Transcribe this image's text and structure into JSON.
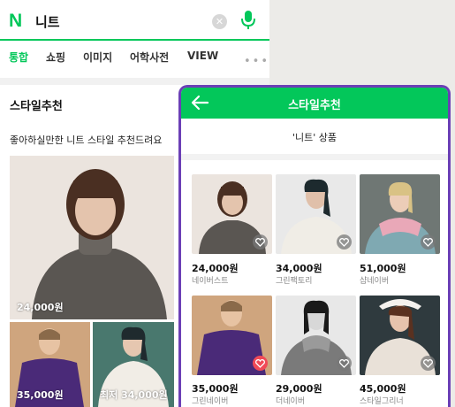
{
  "search": {
    "logo": "N",
    "query": "니트"
  },
  "tabs": [
    "통합",
    "쇼핑",
    "이미지",
    "어학사전",
    "VIEW"
  ],
  "section": {
    "title": "스타일추천",
    "subtitle": "좋아하실만한 니트 스타일 추천드려요",
    "main_price": "24,000원",
    "thumbs": [
      {
        "price": "35,000원"
      },
      {
        "price": "최저 34,000원"
      }
    ]
  },
  "modal": {
    "title": "스타일추천",
    "subtitle": "'니트' 상품",
    "items": [
      {
        "price": "24,000원",
        "shop": "네이버스트",
        "liked": false
      },
      {
        "price": "34,000원",
        "shop": "그린팩토리",
        "liked": false
      },
      {
        "price": "51,000원",
        "shop": "샵네이버",
        "liked": false
      },
      {
        "price": "35,000원",
        "shop": "그린네이버",
        "liked": true
      },
      {
        "price": "29,000원",
        "shop": "더네이버",
        "liked": false
      },
      {
        "price": "45,000원",
        "shop": "스타일그리너",
        "liked": false
      }
    ]
  },
  "colors": {
    "accent": "#03c75a",
    "modal_border": "#6b3fb6",
    "like": "#f04a57"
  }
}
